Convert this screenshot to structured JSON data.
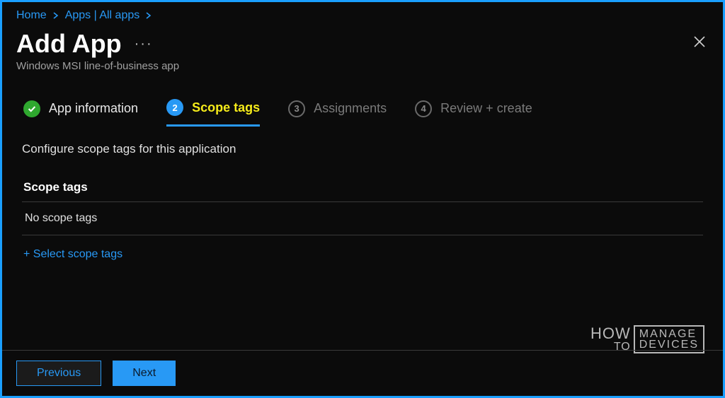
{
  "breadcrumb": {
    "home": "Home",
    "apps": "Apps | All apps"
  },
  "header": {
    "title": "Add App",
    "more": "···",
    "subtitle": "Windows MSI line-of-business app"
  },
  "steps": {
    "s1": {
      "label": "App information"
    },
    "s2": {
      "num": "2",
      "label": "Scope tags"
    },
    "s3": {
      "num": "3",
      "label": "Assignments"
    },
    "s4": {
      "num": "4",
      "label": "Review + create"
    }
  },
  "content": {
    "desc": "Configure scope tags for this application",
    "section_header": "Scope tags",
    "empty_text": "No scope tags",
    "select_link": "+ Select scope tags"
  },
  "footer": {
    "previous": "Previous",
    "next": "Next"
  },
  "watermark": {
    "how": "HOW",
    "to": "TO",
    "manage": "MANAGE",
    "devices": "DEVICES"
  }
}
